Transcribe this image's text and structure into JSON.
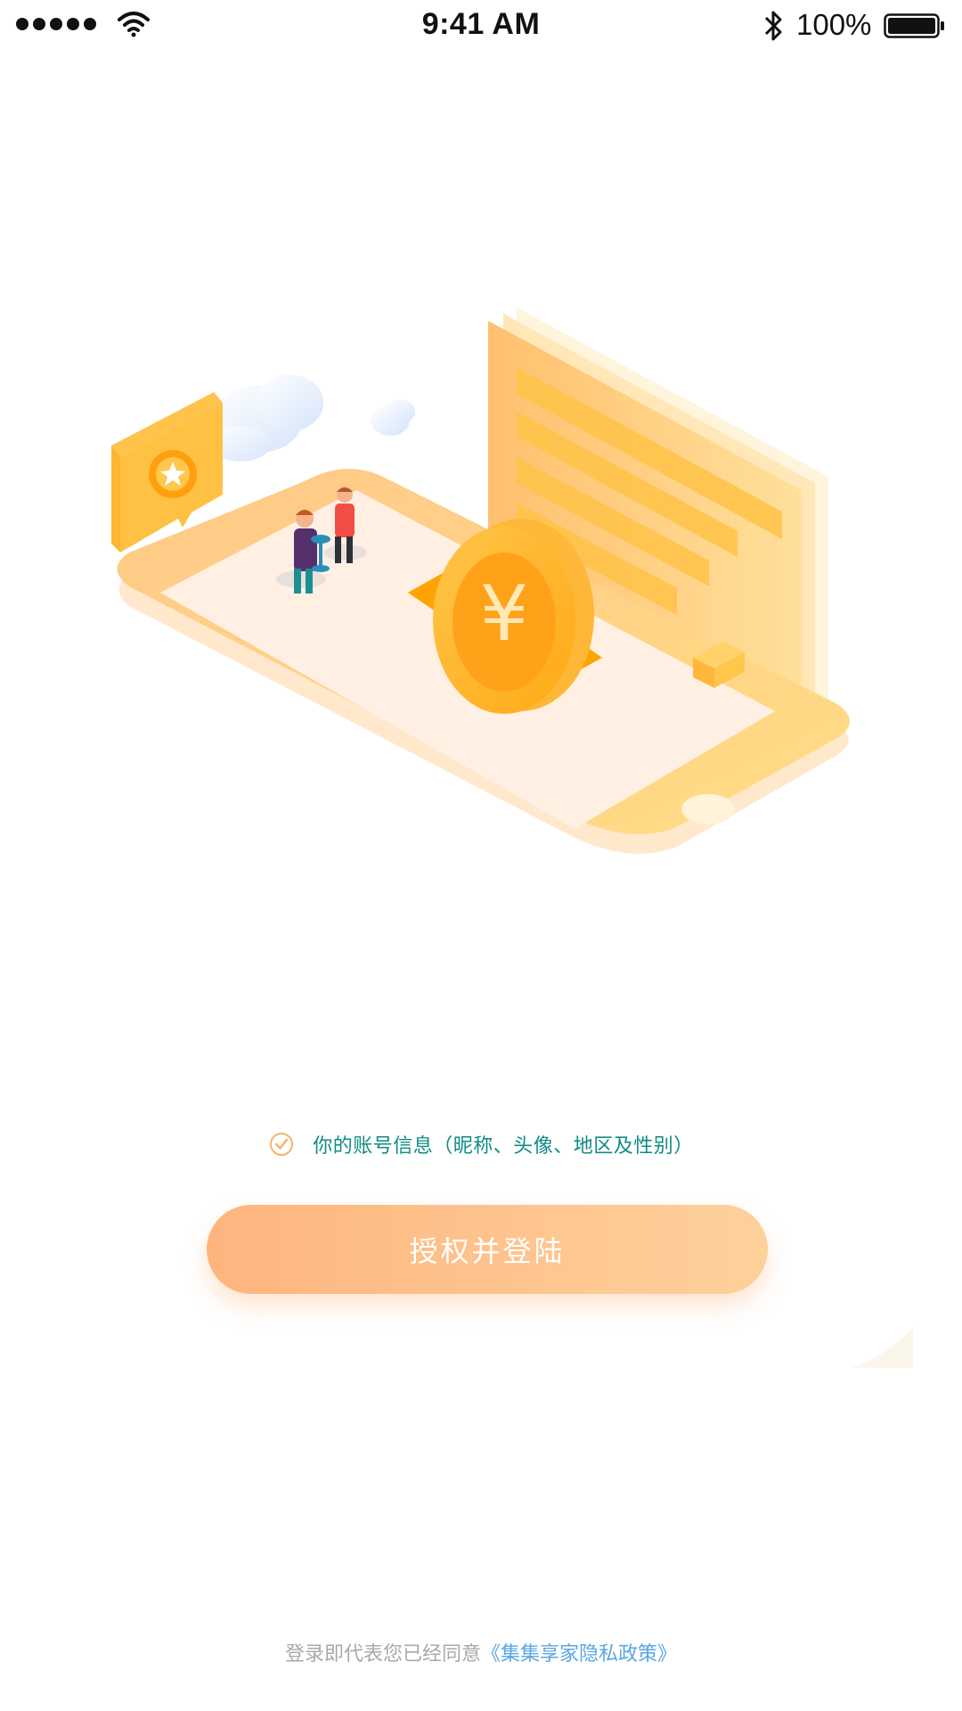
{
  "status_bar": {
    "time": "9:41 AM",
    "battery": "100%",
    "icons": [
      "signal-dots-icon",
      "wifi-icon",
      "bluetooth-icon",
      "battery-icon"
    ]
  },
  "illustration": {
    "icons": [
      "phone-illustration",
      "coin-icon",
      "star-badge-icon",
      "document-icon",
      "cloud-icon"
    ],
    "coin_symbol": "¥"
  },
  "consent": {
    "text": "你的账号信息（昵称、头像、地区及性别）",
    "checked": true
  },
  "auth_button": {
    "label": "授权并登陆"
  },
  "footer": {
    "prefix": "登录即代表您已经同意",
    "link_text": "《集集享家隐私政策》"
  },
  "colors": {
    "accent": "#ffb47e",
    "accent_light": "#fdd19b",
    "teal_text": "#0f8b86",
    "link": "#5aa7e0",
    "muted": "#a9a9a9"
  }
}
